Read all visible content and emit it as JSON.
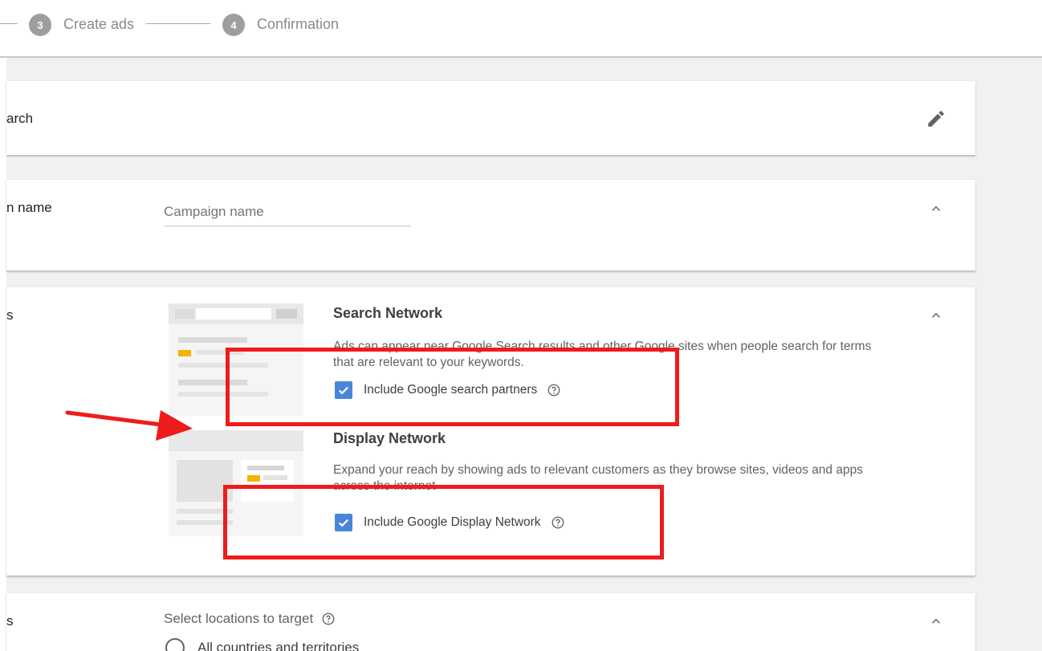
{
  "stepper": {
    "steps": [
      {
        "number": "3",
        "label": "Create ads"
      },
      {
        "number": "4",
        "label": "Confirmation"
      }
    ]
  },
  "campaign_type": {
    "label_fragment": "arch",
    "edit_icon": "pencil-icon"
  },
  "campaign_name": {
    "label_fragment": "n name",
    "placeholder": "Campaign name",
    "value": ""
  },
  "networks": {
    "label_fragment": "s",
    "search": {
      "title": "Search Network",
      "description": "Ads can appear near Google Search results and other Google sites when people search for terms that are relevant to your keywords.",
      "checkbox_label": "Include Google search partners",
      "checked": true
    },
    "display": {
      "title": "Display Network",
      "description": "Expand your reach by showing ads to relevant customers as they browse sites, videos and apps across the internet",
      "checkbox_label": "Include Google Display Network",
      "checked": true
    }
  },
  "locations": {
    "label_fragment": "s",
    "prompt": "Select locations to target",
    "option_all": "All countries and territories"
  },
  "colors": {
    "annotation_red": "#ee1c1c",
    "checkbox_blue": "#4a86d8",
    "accent_yellow": "#f4b400"
  }
}
